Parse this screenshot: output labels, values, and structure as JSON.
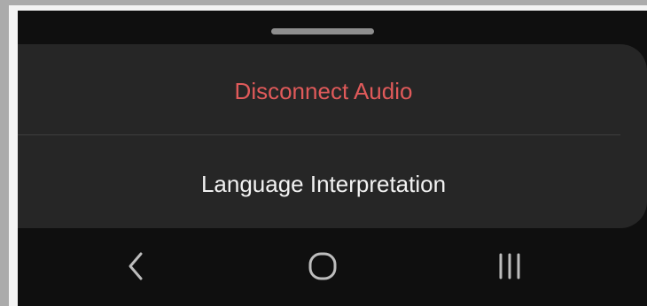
{
  "sheet": {
    "items": [
      {
        "label": "Disconnect Audio",
        "color": "#e05a5a"
      },
      {
        "label": "Language Interpretation",
        "color": "#f2f2f2"
      }
    ]
  },
  "navbar": {
    "buttons": [
      {
        "icon": "back-chevron-icon"
      },
      {
        "icon": "home-circle-icon"
      },
      {
        "icon": "recent-apps-icon"
      }
    ]
  },
  "colors": {
    "sheet_background": "#262626",
    "screen_background": "#0f0f0f",
    "destructive": "#e05a5a",
    "icon": "#bdbdbd"
  }
}
